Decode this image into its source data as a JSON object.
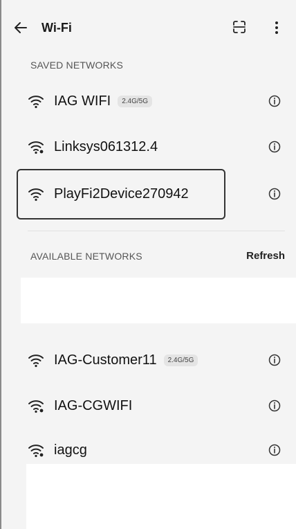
{
  "header": {
    "back_icon": "arrow-left-icon",
    "title": "Wi-Fi",
    "scan_icon": "scan-qr-icon",
    "more_icon": "more-vertical-icon"
  },
  "saved_networks": {
    "label": "SAVED NETWORKS",
    "items": [
      {
        "ssid": "IAG WIFI",
        "badge": "2.4G/5G",
        "icon": "wifi-icon"
      },
      {
        "ssid": "Linksys061312.4",
        "badge": "",
        "icon": "wifi-secured-icon"
      },
      {
        "ssid": "PlayFi2Device270942",
        "badge": "",
        "icon": "wifi-icon"
      }
    ]
  },
  "available_networks": {
    "label": "AVAILABLE NETWORKS",
    "refresh_label": "Refresh",
    "items": [
      {
        "ssid": "IAG-Customer11",
        "badge": "2.4G/5G",
        "icon": "wifi-icon"
      },
      {
        "ssid": "IAG-CGWIFI",
        "badge": "",
        "icon": "wifi-secured-icon"
      },
      {
        "ssid": "iagcg",
        "badge": "",
        "icon": "wifi-secured-icon"
      }
    ]
  }
}
